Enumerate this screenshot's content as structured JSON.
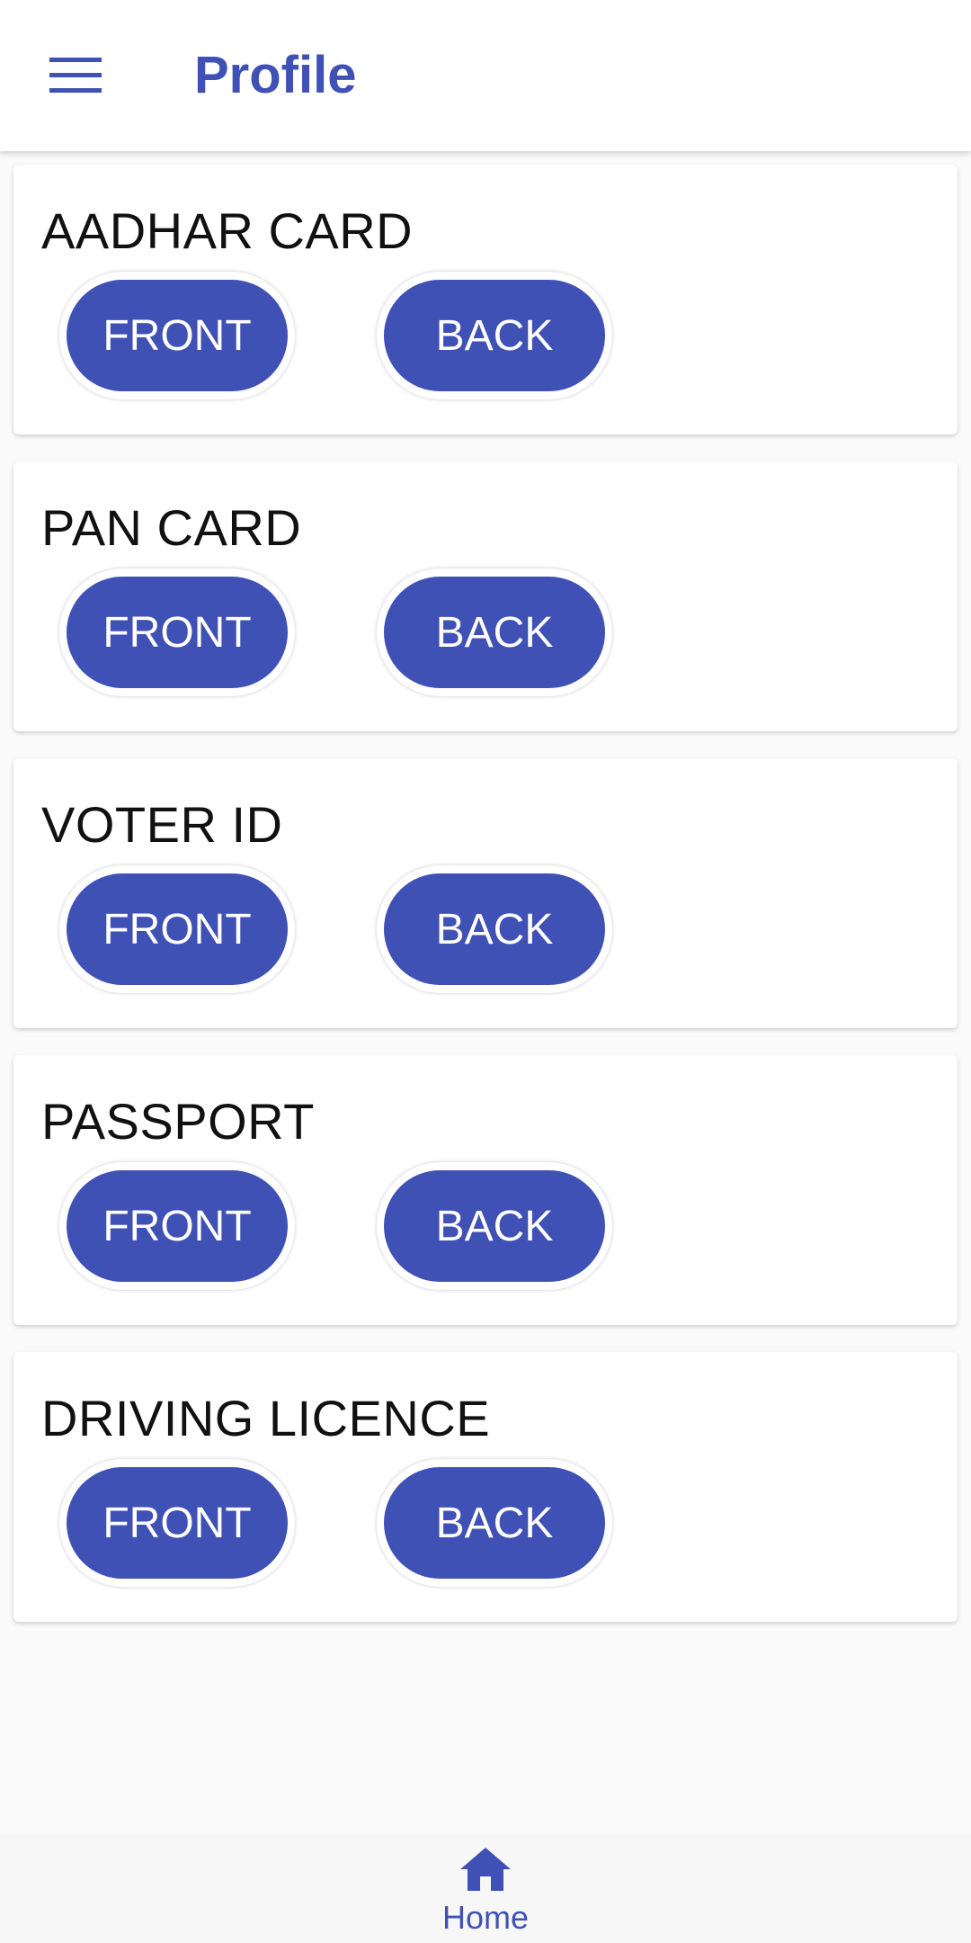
{
  "appbar": {
    "title": "Profile",
    "menu_icon": "hamburger-menu-icon"
  },
  "cards": [
    {
      "title": "AADHAR CARD",
      "front_label": "FRONT",
      "back_label": "BACK"
    },
    {
      "title": "PAN CARD",
      "front_label": "FRONT",
      "back_label": "BACK"
    },
    {
      "title": "VOTER ID",
      "front_label": "FRONT",
      "back_label": "BACK"
    },
    {
      "title": "PASSPORT",
      "front_label": "FRONT",
      "back_label": "BACK"
    },
    {
      "title": "DRIVING LICENCE",
      "front_label": "FRONT",
      "back_label": "BACK"
    }
  ],
  "bottom_nav": {
    "items": [
      {
        "label": "Home",
        "icon": "home-icon",
        "selected": true
      }
    ]
  },
  "colors": {
    "primary": "#3f51b5",
    "background": "#fafafa",
    "card": "#ffffff",
    "text": "#111111"
  }
}
